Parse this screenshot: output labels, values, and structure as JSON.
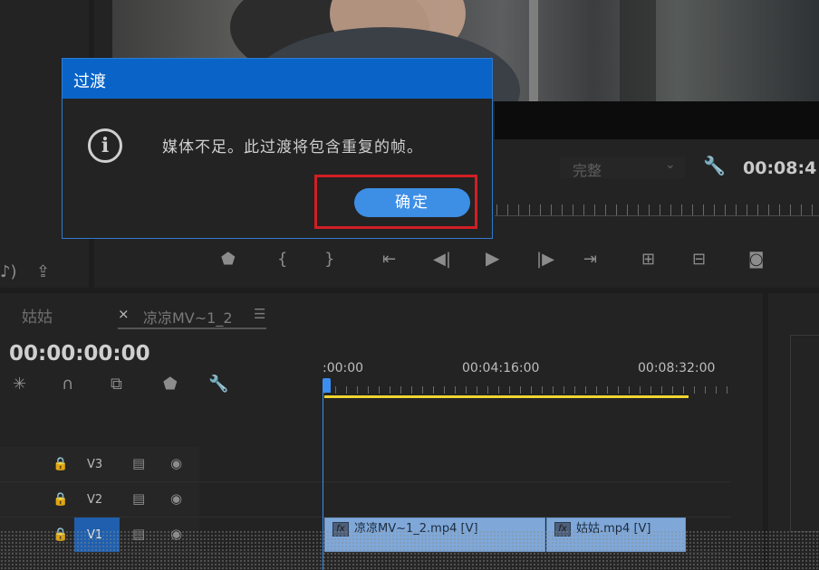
{
  "program_monitor": {
    "quality_value": "完整",
    "timecode": "00:08:4"
  },
  "timeline": {
    "tab_inactive": "姑姑",
    "tab_active": "凉凉MV~1_2",
    "tab_close": "×",
    "tab_menu": "☰",
    "current_timecode": "00:00:00:00",
    "ruler_labels": [
      ":00:00",
      "00:04:16:00",
      "00:08:32:00"
    ],
    "tracks": [
      {
        "name": "V3"
      },
      {
        "name": "V2"
      },
      {
        "name": "V1"
      }
    ],
    "clips": [
      {
        "label": "凉凉MV~1_2.mp4 [V]",
        "fx": "fx"
      },
      {
        "label": "姑姑.mp4 [V]",
        "fx": "fx"
      }
    ]
  },
  "dialog": {
    "title": "过渡",
    "message": "媒体不足。此过渡将包含重复的帧。",
    "ok_label": "确定"
  },
  "colors": {
    "accent_blue": "#0a64c8",
    "button_blue": "#3d8ee5",
    "highlight_red": "#d11f24",
    "work_area_yellow": "#f1d531",
    "clip_blue": "#7fa8d9"
  },
  "icons": {
    "info": "i"
  }
}
